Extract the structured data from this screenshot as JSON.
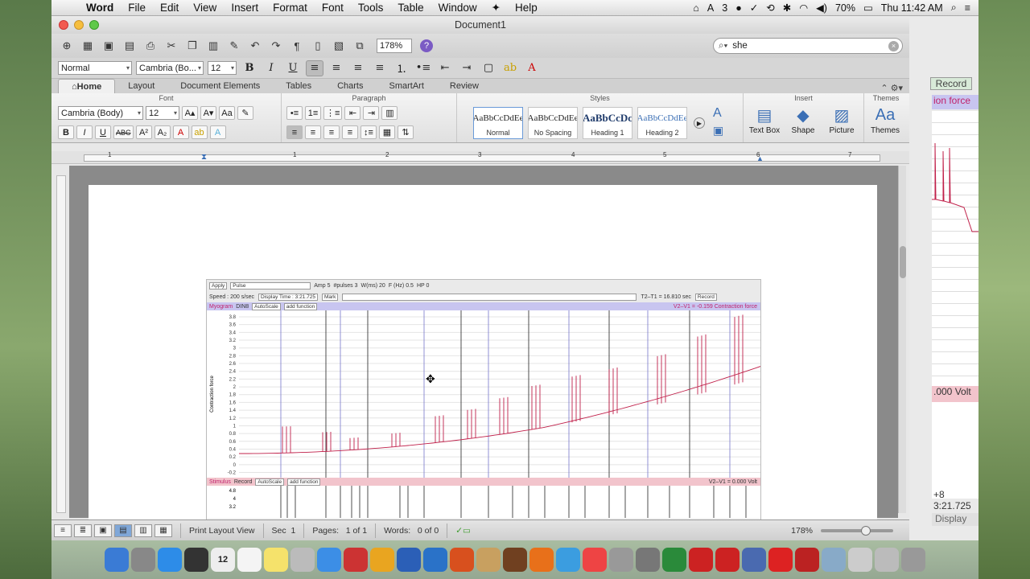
{
  "menubar": {
    "app": "Word",
    "items": [
      "File",
      "Edit",
      "View",
      "Insert",
      "Format",
      "Font",
      "Tools",
      "Table",
      "Window",
      "Help"
    ],
    "status": {
      "battery": "70%",
      "clock": "Thu 11:42 AM",
      "flag_count": "3"
    }
  },
  "window": {
    "title": "Document1",
    "zoom": "178%",
    "search_value": "she"
  },
  "toolbar2": {
    "style": "Normal",
    "font": "Cambria (Bo...",
    "size": "12"
  },
  "tabs": [
    "Home",
    "Layout",
    "Document Elements",
    "Tables",
    "Charts",
    "SmartArt",
    "Review"
  ],
  "ribbon": {
    "groups": {
      "font": "Font",
      "paragraph": "Paragraph",
      "styles": "Styles",
      "insert": "Insert",
      "themes": "Themes"
    },
    "font_name": "Cambria (Body)",
    "font_size": "12",
    "styles": [
      {
        "preview": "AaBbCcDdEe",
        "name": "Normal"
      },
      {
        "preview": "AaBbCcDdEe",
        "name": "No Spacing"
      },
      {
        "preview": "AaBbCcDc",
        "name": "Heading 1"
      },
      {
        "preview": "AaBbCcDdEe",
        "name": "Heading 2"
      }
    ],
    "insert": [
      {
        "label": "Text Box"
      },
      {
        "label": "Shape"
      },
      {
        "label": "Picture"
      }
    ],
    "themes_label": "Themes"
  },
  "ruler": {
    "numbers": [
      "1",
      "1",
      "2",
      "3",
      "4",
      "5",
      "6",
      "7"
    ]
  },
  "status": {
    "view": "Print Layout View",
    "sec_label": "Sec",
    "sec": "1",
    "pages_label": "Pages:",
    "pages": "1 of 1",
    "words_label": "Words:",
    "words": "0 of 0",
    "zoom": "178%"
  },
  "screenshot": {
    "apply": "Apply",
    "pulse": "Pulse",
    "amp": "Amp 5",
    "pulses": "#pulses 3",
    "wms": "W(ms) 20",
    "fhz": "F (Hz) 0.5",
    "hp": "HP 0",
    "speed": "Speed : 200 s/sec",
    "display_time": "Display Time : 3:21.725",
    "mark": "Mark",
    "t2t1": "T2–T1 = 16.810 sec",
    "record": "Record",
    "channel1": {
      "name": "Myogram",
      "din": "DIN8",
      "autoscale": "AutoScale",
      "add": "add function",
      "readout": "V2–V1 = -0.159 Contraction force",
      "ylabel": "Contraction force"
    },
    "channel2": {
      "name": "Stimulus",
      "din": "Record",
      "autoscale": "AutoScale",
      "add": "add function",
      "readout": "V2–V1 = 0.000 Volt"
    },
    "y_ticks": [
      "3.8",
      "3.6",
      "3.4",
      "3.2",
      "3",
      "2.8",
      "2.6",
      "2.4",
      "2.2",
      "2",
      "1.8",
      "1.6",
      "1.4",
      "1.2",
      "1",
      "0.8",
      "0.6",
      "0.4",
      "0.2",
      "0",
      "-0.2"
    ],
    "y2_ticks": [
      "4.8",
      "4",
      "3.2"
    ]
  },
  "right_window": {
    "record": "Record",
    "force": "ion force",
    "volt": ".000 Volt",
    "time": "+8\n3:21.725",
    "display": "Display"
  },
  "dock": {
    "apps": [
      "Finder",
      "Launchpad",
      "App Store",
      "Dashboard",
      "Calendar",
      "TextEdit",
      "Stickies",
      "Calculator",
      "iTunes",
      "iWorx",
      "Office",
      "Word",
      "Outlook",
      "PowerPoint",
      "Preview",
      "GarageBand",
      "Firefox",
      "Safari",
      "Chrome",
      "Migration",
      "Utilities",
      "Excel",
      "Acrobat",
      "Camera",
      "Box",
      "PDF",
      "Dictionary",
      "Folder",
      "Documents",
      "Downloads",
      "Trash"
    ],
    "calendar_day": "12"
  },
  "colors": {
    "accent": "#3b6fb5",
    "trace": "#c0204a",
    "channel_bar": "#c8c5f0",
    "stim_bar": "#f2c4cc"
  }
}
